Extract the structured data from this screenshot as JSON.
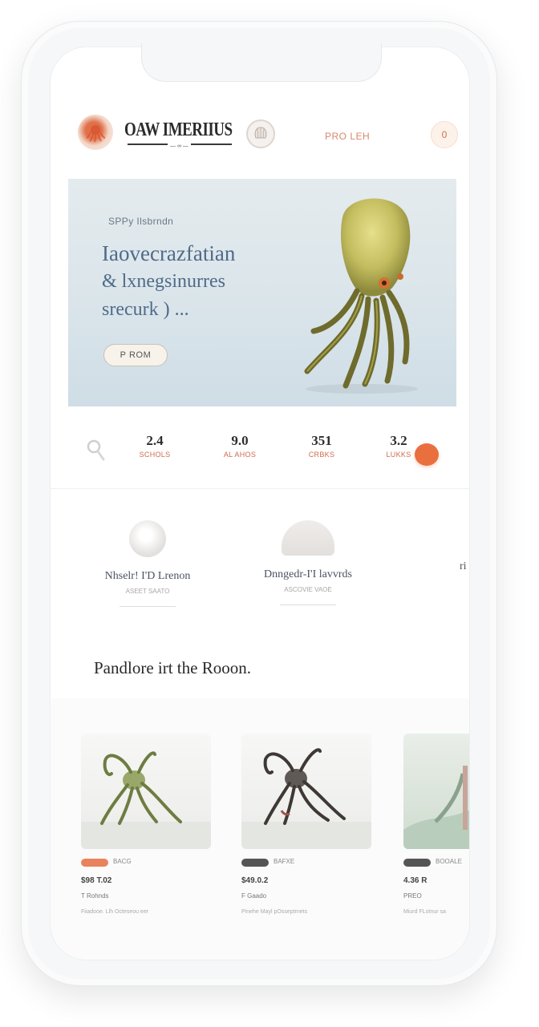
{
  "header": {
    "logo_icon": "octopus-logo-icon",
    "brand": "OAW IMERIIUS",
    "brand_sub": "— ∞ —",
    "emblem_icon": "shell-emblem-icon",
    "link_label": "PRO LEH",
    "cart_count": "0"
  },
  "hero": {
    "kicker": "SPPy Ilsbrndn",
    "title_l1": "Iaovecrazfatian",
    "title_l2": "& lxnegsinurres",
    "title_l3": "srecurk ) ...",
    "button_label": "P ROM",
    "art_icon": "cthulhu-octopus-illustration"
  },
  "stats": {
    "search_icon": "search-icon",
    "items": [
      {
        "value": "2.4",
        "label": "SCHOLS"
      },
      {
        "value": "9.0",
        "label": "AL AHOS"
      },
      {
        "value": "351",
        "label": "CRBKS"
      },
      {
        "value": "3.2",
        "label": "LUKKS"
      }
    ],
    "accent": "#e9703e"
  },
  "features": [
    {
      "title": "Nhselr! I'D Lrenon",
      "sub": "ASEET SAATO"
    },
    {
      "title": "Dnngedr-I'I lavvrds",
      "sub": "ASCOVIE VAOE"
    }
  ],
  "feature_edge_text": "ri",
  "section_title": "Pandlore irt the Rooon.",
  "products": [
    {
      "tag": "BACG",
      "price": "$98 T.02",
      "name": "T Rohnds",
      "desc": "Fiiadooe. Llh Octeseou eer",
      "tag_color": "#e9835e"
    },
    {
      "tag": "BAFXE",
      "price": "$49.0.2",
      "name": "F Gaado",
      "desc": "Pinehe Mayl pOsseptrnets",
      "tag_color": "#555555"
    },
    {
      "tag": "BOOALE",
      "price": "4.36 R",
      "name": "PREO",
      "desc": "Miurd FLotnur sa",
      "tag_color": "#555555"
    }
  ]
}
